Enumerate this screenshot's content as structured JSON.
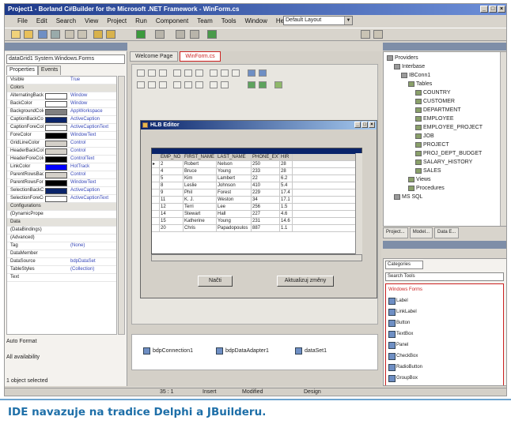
{
  "window": {
    "title": "Project1 - Borland C#Builder for the Microsoft .NET Framework - WinForm.cs",
    "min": "_",
    "max": "□",
    "close": "×"
  },
  "menu": [
    "File",
    "Edit",
    "Search",
    "View",
    "Project",
    "Run",
    "Component",
    "Team",
    "Tools",
    "Window",
    "Help"
  ],
  "layout_combo": "Default Layout",
  "object_inspector": {
    "object": "dataGrid1  System.Windows.Forms",
    "tabs": [
      "Properties",
      "Events"
    ],
    "rows": [
      {
        "name": "Visible",
        "value": "True",
        "color": ""
      },
      {
        "name": "Colors",
        "value": "",
        "color": "",
        "category": true
      },
      {
        "name": "AlternatingBack",
        "value": "Window",
        "color": "#ffffff"
      },
      {
        "name": "BackColor",
        "value": "Window",
        "color": "#ffffff"
      },
      {
        "name": "BackgroundColor",
        "value": "AppWorkspace",
        "color": "#808080"
      },
      {
        "name": "CaptionBackColor",
        "value": "ActiveCaption",
        "color": "#0a246a"
      },
      {
        "name": "CaptionForeColor",
        "value": "ActiveCaptionText",
        "color": "#ffffff"
      },
      {
        "name": "ForeColor",
        "value": "WindowText",
        "color": "#000000"
      },
      {
        "name": "GridLineColor",
        "value": "Control",
        "color": "#d4d0c8"
      },
      {
        "name": "HeaderBackColor",
        "value": "Control",
        "color": "#d4d0c8"
      },
      {
        "name": "HeaderForeColor",
        "value": "ControlText",
        "color": "#000000"
      },
      {
        "name": "LinkColor",
        "value": "HotTrack",
        "color": "#0000ff"
      },
      {
        "name": "ParentRowsBackColor",
        "value": "Control",
        "color": "#d4d0c8"
      },
      {
        "name": "ParentRowsForeColor",
        "value": "WindowText",
        "color": "#000000"
      },
      {
        "name": "SelectionBackColor",
        "value": "ActiveCaption",
        "color": "#0a246a"
      },
      {
        "name": "SelectionForeColor",
        "value": "ActiveCaptionText",
        "color": "#ffffff"
      },
      {
        "name": "Configurations",
        "value": "",
        "color": "",
        "category": true
      },
      {
        "name": "(DynamicProperties)",
        "value": "",
        "color": ""
      },
      {
        "name": "Data",
        "value": "",
        "color": "",
        "category": true
      },
      {
        "name": "(DataBindings)",
        "value": "",
        "color": ""
      },
      {
        "name": "(Advanced)",
        "value": "",
        "color": ""
      },
      {
        "name": "Tag",
        "value": "(None)",
        "color": ""
      },
      {
        "name": "DataMember",
        "value": "",
        "color": ""
      },
      {
        "name": "DataSource",
        "value": "bdpDataSet",
        "color": ""
      },
      {
        "name": "TableStyles",
        "value": "(Collection)",
        "color": ""
      },
      {
        "name": "Text",
        "value": "",
        "color": ""
      }
    ],
    "footer_format": "Auto Format",
    "footer_availability": "All availability",
    "status": "1 object selected"
  },
  "doc_tabs": [
    "Welcome Page",
    "WinForm.cs"
  ],
  "form": {
    "title": "HLB Editor",
    "grid": {
      "columns": [
        "",
        "EMP_NO",
        "FIRST_NAME",
        "LAST_NAME",
        "PHONE_EXT",
        "HIR"
      ],
      "rows": [
        [
          "▸",
          "2",
          "Robert",
          "Nelson",
          "250",
          "28"
        ],
        [
          "",
          "4",
          "Bruce",
          "Young",
          "233",
          "28"
        ],
        [
          "",
          "5",
          "Kim",
          "Lambert",
          "22",
          "6.2"
        ],
        [
          "",
          "8",
          "Leslie",
          "Johnson",
          "410",
          "5.4"
        ],
        [
          "",
          "9",
          "Phil",
          "Forest",
          "229",
          "17.4"
        ],
        [
          "",
          "11",
          "K. J.",
          "Weston",
          "34",
          "17.1"
        ],
        [
          "",
          "12",
          "Terri",
          "Lee",
          "256",
          "1.5"
        ],
        [
          "",
          "14",
          "Stewart",
          "Hall",
          "227",
          "4.6"
        ],
        [
          "",
          "15",
          "Katherine",
          "Young",
          "231",
          "14.6"
        ],
        [
          "",
          "20",
          "Chris",
          "Papadopoulos",
          "887",
          "1.1"
        ]
      ]
    },
    "buttons": [
      "Načti",
      "Aktualizuj změny"
    ]
  },
  "tray": [
    "bdpConnection1",
    "bdpDataAdapter1",
    "dataSet1"
  ],
  "project_tree": [
    {
      "label": "Providers",
      "indent": 0,
      "db": true
    },
    {
      "label": "Interbase",
      "indent": 1,
      "db": true
    },
    {
      "label": "IBConn1",
      "indent": 2,
      "db": true
    },
    {
      "label": "Tables",
      "indent": 3,
      "db": false
    },
    {
      "label": "COUNTRY",
      "indent": 4,
      "db": false
    },
    {
      "label": "CUSTOMER",
      "indent": 4,
      "db": false
    },
    {
      "label": "DEPARTMENT",
      "indent": 4,
      "db": false
    },
    {
      "label": "EMPLOYEE",
      "indent": 4,
      "db": false
    },
    {
      "label": "EMPLOYEE_PROJECT",
      "indent": 4,
      "db": false
    },
    {
      "label": "JOB",
      "indent": 4,
      "db": false
    },
    {
      "label": "PROJECT",
      "indent": 4,
      "db": false
    },
    {
      "label": "PROJ_DEPT_BUDGET",
      "indent": 4,
      "db": false
    },
    {
      "label": "SALARY_HISTORY",
      "indent": 4,
      "db": false
    },
    {
      "label": "SALES",
      "indent": 4,
      "db": false
    },
    {
      "label": "Views",
      "indent": 3,
      "db": false
    },
    {
      "label": "Procedures",
      "indent": 3,
      "db": false
    },
    {
      "label": "MS SQL",
      "indent": 1,
      "db": true
    }
  ],
  "right_tabs": [
    "Project...",
    "Model...",
    "Data E..."
  ],
  "toolbox": {
    "combo": "Categories",
    "search": "Search Tools",
    "items": [
      {
        "label": "Windows Forms",
        "head": true
      },
      {
        "label": "Label",
        "head": false
      },
      {
        "label": "LinkLabel",
        "head": false
      },
      {
        "label": "Button",
        "head": false
      },
      {
        "label": "TextBox",
        "head": false
      },
      {
        "label": "Panel",
        "head": false
      },
      {
        "label": "CheckBox",
        "head": false
      },
      {
        "label": "RadioButton",
        "head": false
      },
      {
        "label": "GroupBox",
        "head": false
      }
    ]
  },
  "statusbar": {
    "position": "35 : 1",
    "mode": "Insert",
    "state": "Modified",
    "view": "Design"
  },
  "caption": "IDE navazuje na tradice Delphi a JBuilderu."
}
